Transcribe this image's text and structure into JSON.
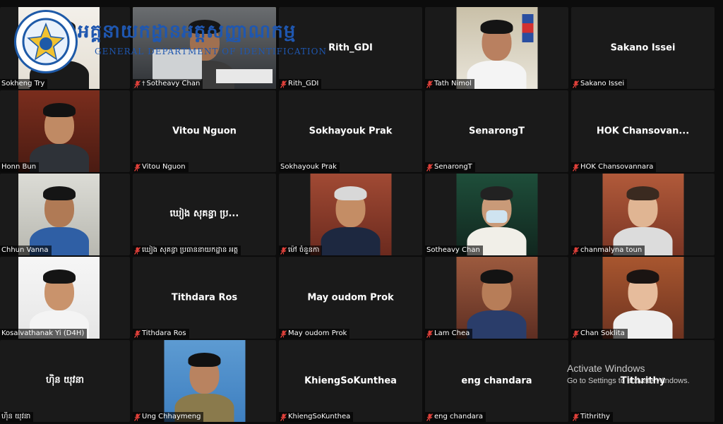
{
  "brand": {
    "khmer_title": "អគ្គនាយកដ្ឋានអត្តសញ្ញាណកម្ម",
    "english_title": "GENERAL DEPARTMENT OF IDENTIFICATION",
    "primary_color": "#1f57b0"
  },
  "colors": {
    "active_speaker_border": "#c8d84a",
    "mute_icon": "#e0403a"
  },
  "participants": [
    {
      "label": "Sokheng Try",
      "display_name": "",
      "video": true,
      "muted": false,
      "pinned": false
    },
    {
      "label": "Sotheavy Chan",
      "display_name": "",
      "video": true,
      "muted": true,
      "pinned": true,
      "active": true
    },
    {
      "label": "Rith_GDI",
      "display_name": "Rith_GDI",
      "video": false,
      "muted": true
    },
    {
      "label": "Tath Nimol",
      "display_name": "",
      "video": true,
      "muted": true
    },
    {
      "label": "Sakano Issei",
      "display_name": "Sakano Issei",
      "video": false,
      "muted": true
    },
    {
      "label": "Honn Bun",
      "display_name": "",
      "video": true,
      "muted": false
    },
    {
      "label": "Vitou Nguon",
      "display_name": "Vitou Nguon",
      "video": false,
      "muted": true
    },
    {
      "label": "Sokhayouk Prak",
      "display_name": "Sokhayouk Prak",
      "video": false,
      "muted": false
    },
    {
      "label": "SenarongT",
      "display_name": "SenarongT",
      "video": false,
      "muted": true
    },
    {
      "label": "HOK Chansovannara",
      "display_name": "HOK  Chansovan...",
      "video": false,
      "muted": true
    },
    {
      "label": "Chhun Vanna",
      "display_name": "",
      "video": true,
      "muted": false
    },
    {
      "label": "ឃៀង សុគន្ធា ប្រធាននាយកដ្ឋាន អត្ត",
      "display_name": "ឃៀង សុគន្ធា ប្រ...",
      "video": false,
      "muted": true
    },
    {
      "label": "ម៉ៅ ចំនួនកា",
      "display_name": "",
      "video": true,
      "muted": true
    },
    {
      "label": "Sotheavy Chan",
      "display_name": "",
      "video": true,
      "muted": false
    },
    {
      "label": "chanmalyna toun",
      "display_name": "",
      "video": true,
      "muted": true
    },
    {
      "label": "Kosalvathanak Yi (D4H)",
      "display_name": "",
      "video": true,
      "muted": false
    },
    {
      "label": "Tithdara Ros",
      "display_name": "Tithdara Ros",
      "video": false,
      "muted": true
    },
    {
      "label": "May oudom Prok",
      "display_name": "May oudom Prok",
      "video": false,
      "muted": true
    },
    {
      "label": "Lam Chea",
      "display_name": "",
      "video": true,
      "muted": true
    },
    {
      "label": "Chan Soklita",
      "display_name": "",
      "video": true,
      "muted": true
    },
    {
      "label": "ហ៊ិន យុវនា",
      "display_name": "ហ៊ិន យុវនា",
      "video": false,
      "muted": false
    },
    {
      "label": "Ung Chhaymeng",
      "display_name": "",
      "video": true,
      "muted": true
    },
    {
      "label": "KhiengSoKunthea",
      "display_name": "KhiengSoKunthea",
      "video": false,
      "muted": true
    },
    {
      "label": "eng chandara",
      "display_name": "eng chandara",
      "video": false,
      "muted": true
    },
    {
      "label": "Tithrithy",
      "display_name": "Tithrithy",
      "video": false,
      "muted": true
    }
  ],
  "watermark": {
    "line1": "Activate Windows",
    "line2": "Go to Settings to activate Windows."
  }
}
